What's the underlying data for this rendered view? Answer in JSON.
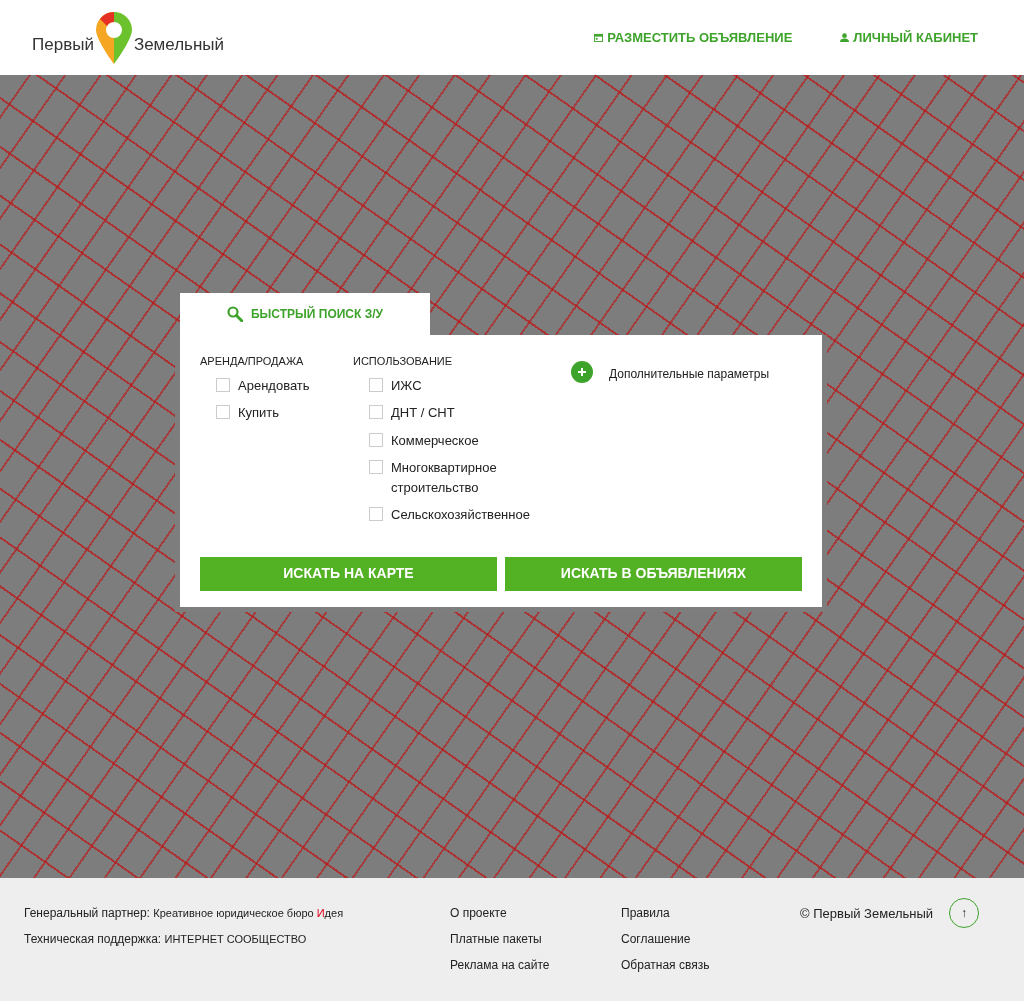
{
  "header": {
    "logo": {
      "left": "Первый",
      "right": "Земельный"
    },
    "nav": [
      {
        "label": "РАЗМЕСТИТЬ ОБЪЯВЛЕНИЕ",
        "kind": "calendar"
      },
      {
        "label": "ЛИЧНЫЙ КАБИНЕТ",
        "kind": "user"
      }
    ]
  },
  "search": {
    "tab": {
      "label": "БЫСТРЫЙ ПОИСК З/У",
      "selected": true
    },
    "groups": [
      {
        "title": "АРЕНДА/ПРОДАЖА",
        "options": [
          {
            "label": "Арендовать",
            "checked": false
          },
          {
            "label": "Купить",
            "checked": false
          }
        ]
      },
      {
        "title": "ИСПОЛЬЗОВАНИЕ",
        "options": [
          {
            "label": "ИЖС",
            "checked": false
          },
          {
            "label": "ДНТ / СНТ",
            "checked": false
          },
          {
            "label": "Коммерческое",
            "checked": false
          },
          {
            "label": "Многоквартирное строительство",
            "checked": false
          },
          {
            "label": "Сельскохозяйственное",
            "checked": false
          }
        ]
      }
    ],
    "more_params": "Дополнительные параметры",
    "buttons": [
      "ИСКАТЬ НА КАРТЕ",
      "ИСКАТЬ В ОБЪЯВЛЕНИЯХ"
    ]
  },
  "footer": {
    "partner": {
      "label": "Генеральный партнер:",
      "name_prefix": "Креативное юридическое бюро ",
      "name_accent": "И",
      "name_rest": "дея"
    },
    "support": {
      "label": "Техническая поддержка:",
      "name": "ИНТЕРНЕТ СООБЩЕСТВО"
    },
    "links_1": [
      "О проекте",
      "Платные пакеты",
      "Реклама на сайте"
    ],
    "links_2": [
      "Правила",
      "Соглашение",
      "Обратная связь"
    ],
    "copyright": "© Первый Земельный",
    "to_top": "↑"
  }
}
